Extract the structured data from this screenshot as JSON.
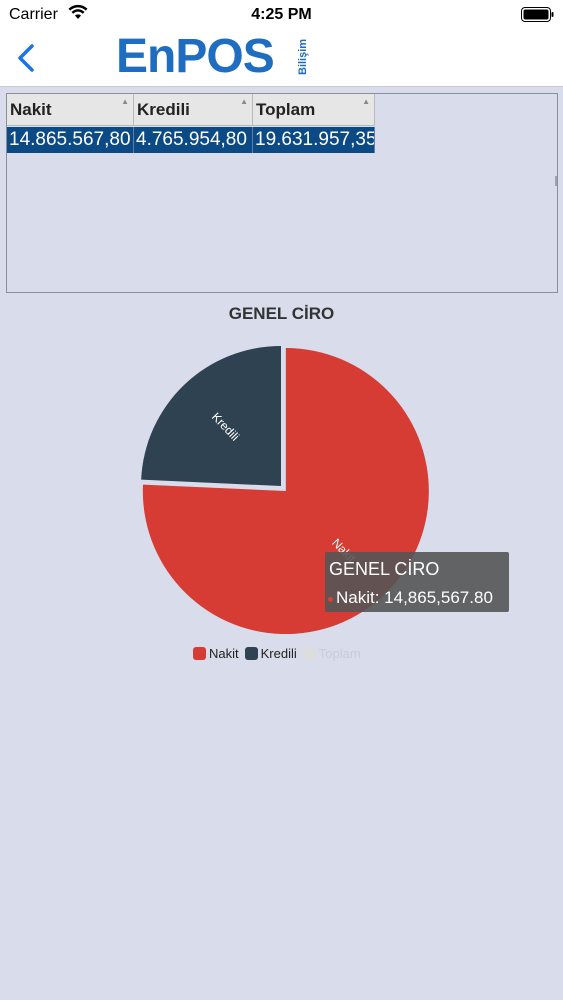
{
  "statusbar": {
    "carrier": "Carrier",
    "time": "4:25 PM"
  },
  "navbar": {
    "brand": "EnPOS",
    "brand_sub": "Bilişim"
  },
  "grid": {
    "columns": [
      "Nakit",
      "Kredili",
      "Toplam"
    ],
    "rows": [
      [
        "14.865.567,80",
        "4.765.954,80",
        "19.631.957,35"
      ]
    ]
  },
  "chart_data": {
    "type": "pie",
    "title": "GENEL CİRO",
    "categories": [
      "Nakit",
      "Kredili",
      "Toplam"
    ],
    "values": [
      14865567.8,
      4765954.8,
      0
    ],
    "colors": [
      "#d63b34",
      "#2f4251",
      "#dddddd"
    ],
    "slice_labels": [
      "Nakit",
      "Kredili"
    ],
    "legend": {
      "position": "bottom",
      "entries": [
        "Nakit",
        "Kredili",
        "Toplam"
      ],
      "hidden": [
        "Toplam"
      ]
    },
    "tooltip": {
      "title": "GENEL CİRO",
      "text": "Nakit: 14,865,567.80"
    }
  }
}
